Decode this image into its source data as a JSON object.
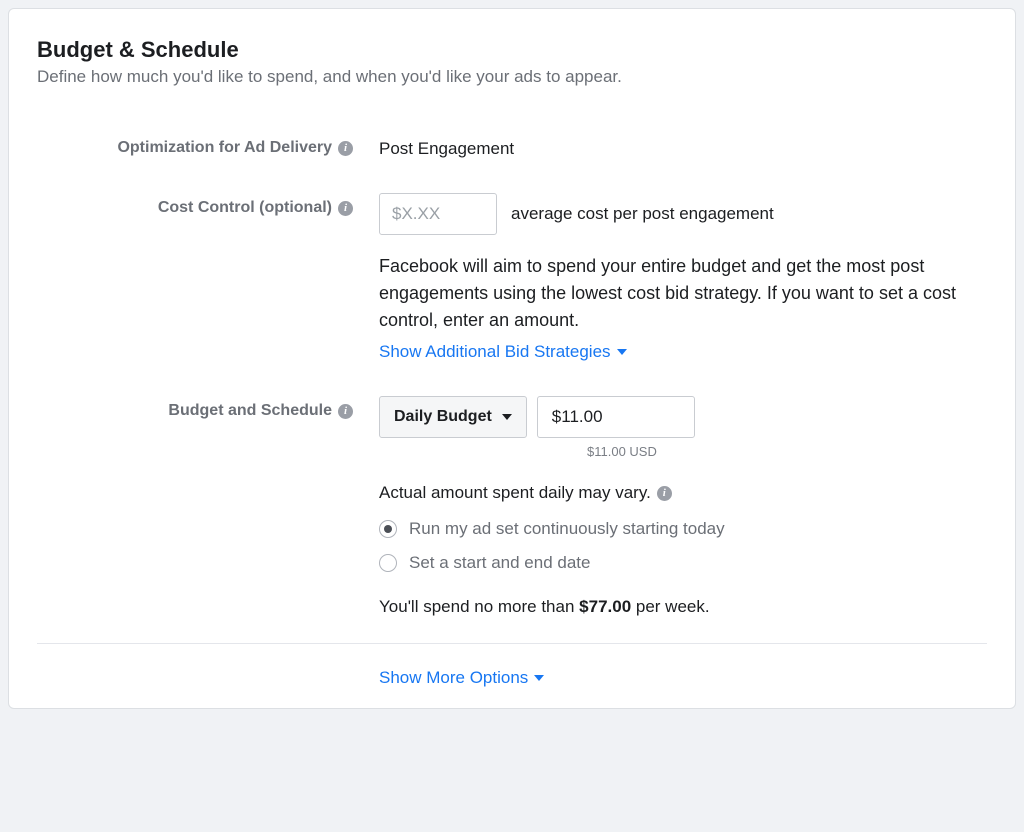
{
  "header": {
    "title": "Budget & Schedule",
    "subtitle": "Define how much you'd like to spend, and when you'd like your ads to appear."
  },
  "optimization": {
    "label": "Optimization for Ad Delivery",
    "value": "Post Engagement"
  },
  "cost_control": {
    "label": "Cost Control (optional)",
    "placeholder": "$X.XX",
    "inline_label": "average cost per post engagement",
    "helper_text": "Facebook will aim to spend your entire budget and get the most post engagements using the lowest cost bid strategy. If you want to set a cost control, enter an amount.",
    "link_label": "Show Additional Bid Strategies"
  },
  "budget_schedule": {
    "label": "Budget and Schedule",
    "budget_type": "Daily Budget",
    "amount": "$11.00",
    "sub_amount": "$11.00 USD",
    "actual_note": "Actual amount spent daily may vary.",
    "radio": {
      "continuous": "Run my ad set continuously starting today",
      "range": "Set a start and end date"
    },
    "spend_summary_prefix": "You'll spend no more than ",
    "spend_summary_amount": "$77.00",
    "spend_summary_suffix": " per week."
  },
  "footer": {
    "show_more": "Show More Options"
  },
  "icons": {
    "info_glyph": "i"
  }
}
